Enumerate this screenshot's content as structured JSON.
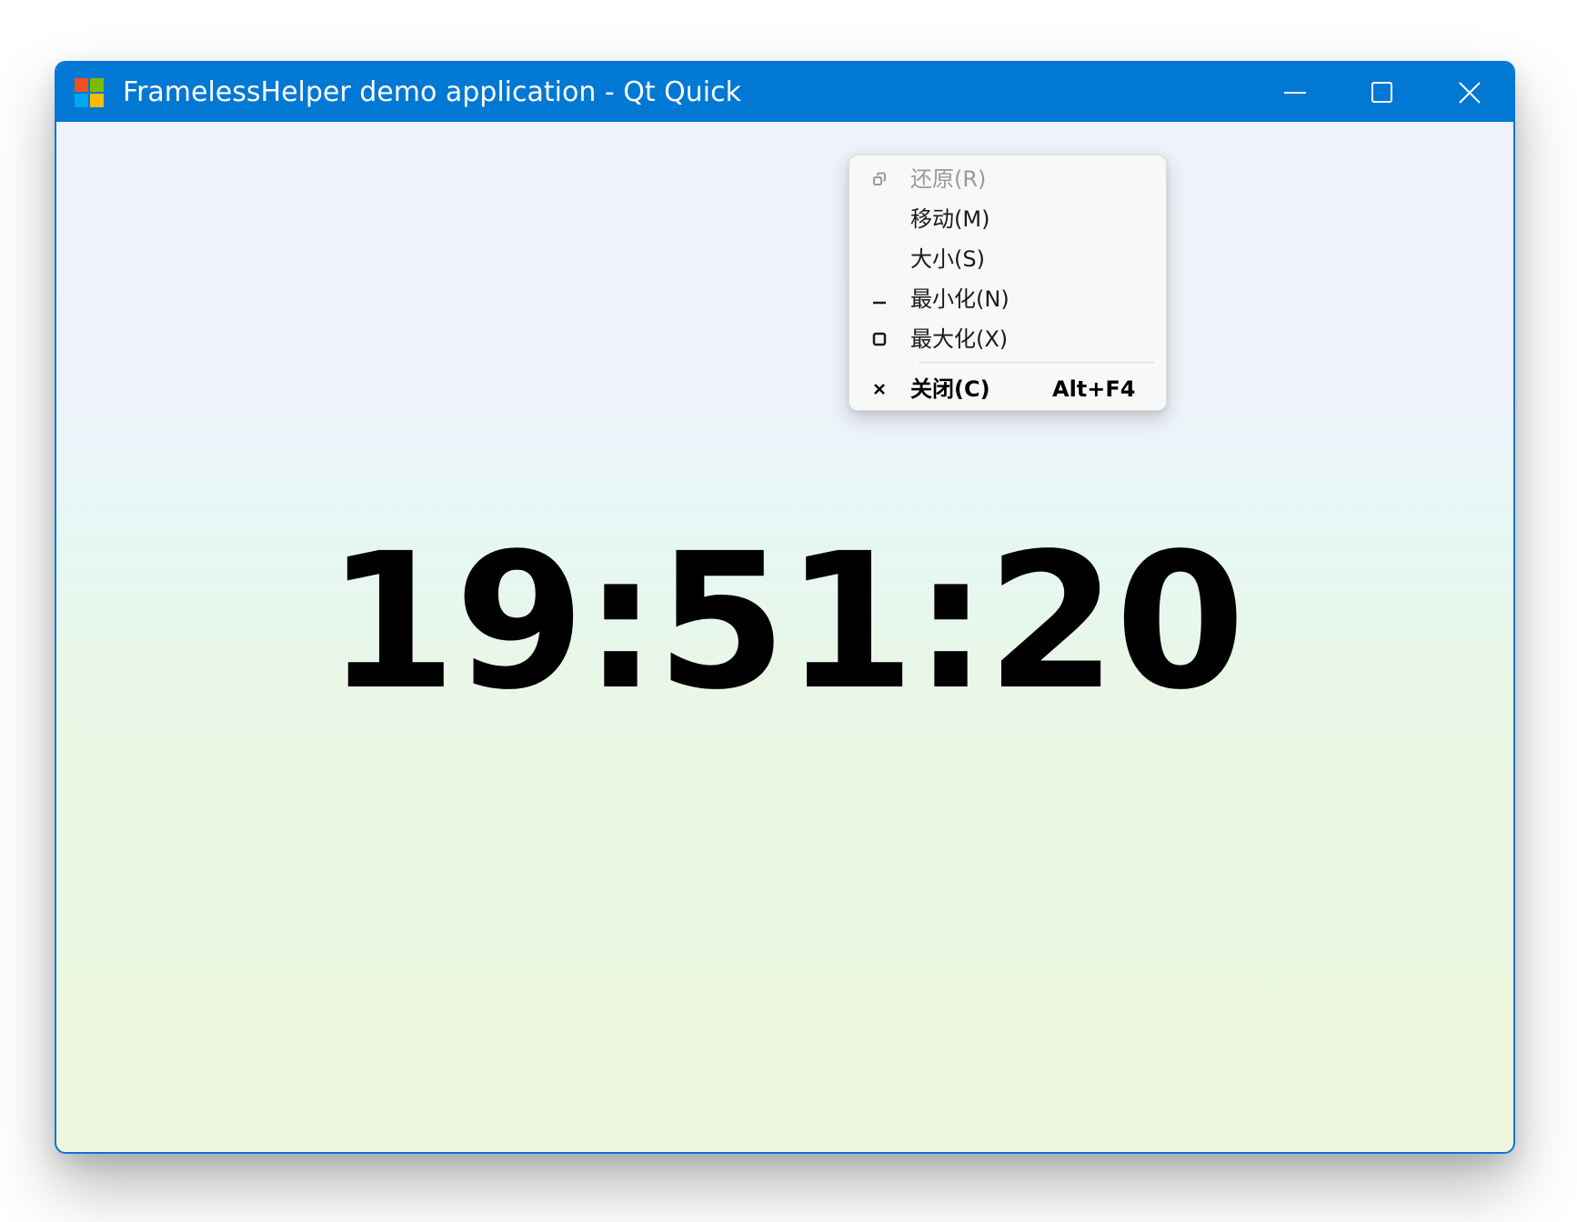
{
  "window": {
    "title": "FramelessHelper demo application - Qt Quick",
    "icon": "windows-logo-icon",
    "accent_color": "#0078d4"
  },
  "caption_buttons": {
    "minimize_icon": "minimize-icon",
    "maximize_icon": "maximize-icon",
    "close_icon": "close-icon"
  },
  "clock": {
    "time": "19:51:20"
  },
  "system_menu": {
    "items": [
      {
        "label": "还原(R)",
        "icon": "restore-icon",
        "enabled": false
      },
      {
        "label": "移动(M)",
        "icon": "",
        "enabled": true
      },
      {
        "label": "大小(S)",
        "icon": "",
        "enabled": true
      },
      {
        "label": "最小化(N)",
        "icon": "minimize-icon",
        "enabled": true
      },
      {
        "label": "最大化(X)",
        "icon": "maximize-icon",
        "enabled": true
      },
      {
        "label": "关闭(C)",
        "icon": "close-icon",
        "enabled": true,
        "shortcut": "Alt+F4"
      }
    ]
  }
}
